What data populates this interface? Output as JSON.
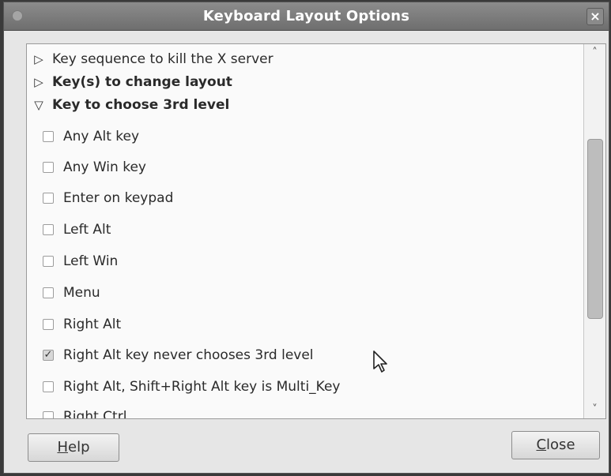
{
  "window": {
    "title": "Keyboard Layout Options"
  },
  "tree": {
    "sections": [
      {
        "label": "Key sequence to kill the X server",
        "expanded": false,
        "bold": false
      },
      {
        "label": "Key(s) to change layout",
        "expanded": false,
        "bold": true
      },
      {
        "label": "Key to choose 3rd level",
        "expanded": true,
        "bold": true
      }
    ],
    "options": [
      {
        "label": "Any Alt key",
        "checked": false
      },
      {
        "label": "Any Win key",
        "checked": false
      },
      {
        "label": "Enter on keypad",
        "checked": false
      },
      {
        "label": "Left Alt",
        "checked": false
      },
      {
        "label": "Left Win",
        "checked": false
      },
      {
        "label": "Menu",
        "checked": false
      },
      {
        "label": "Right Alt",
        "checked": false
      },
      {
        "label": "Right Alt key never chooses 3rd level",
        "checked": true
      },
      {
        "label": "Right Alt, Shift+Right Alt key is Multi_Key",
        "checked": false
      },
      {
        "label": "Right Ctrl",
        "checked": false
      }
    ]
  },
  "buttons": {
    "help": {
      "mnemonic": "H",
      "rest": "elp"
    },
    "close": {
      "mnemonic": "C",
      "rest": "lose"
    }
  },
  "icons": {
    "collapsed": "triangle-right-icon",
    "expanded": "triangle-down-icon",
    "checkbox_checked": "check-icon",
    "scroll_up": "chevron-up-icon",
    "scroll_down": "chevron-down-icon",
    "pointer": "mouse-pointer-icon"
  }
}
